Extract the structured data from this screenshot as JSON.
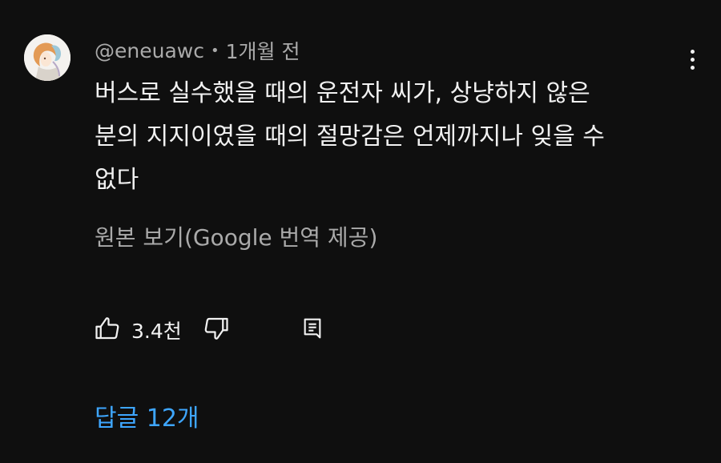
{
  "comment": {
    "author": "@eneuawc",
    "separator": "•",
    "time": "1개월 전",
    "text_lines": [
      "버스로 실수했을 때의 운전자 씨가, 상냥하지 않은",
      "분의 지지이였을 때의 절망감은 언제까지나 잊을 수",
      "없다"
    ],
    "translate_label": "원본 보기(Google 번역 제공)",
    "like_count": "3.4천",
    "replies_label": "답글 12개"
  },
  "icons": {
    "avatar": "avatar",
    "more": "more-vert-icon",
    "like": "thumb-up-icon",
    "dislike": "thumb-down-icon",
    "reply": "reply-comment-icon"
  },
  "colors": {
    "background": "#0f0f0f",
    "text_primary": "#f1f1f1",
    "text_secondary": "#aaaaaa",
    "link_blue": "#3ea6ff"
  }
}
